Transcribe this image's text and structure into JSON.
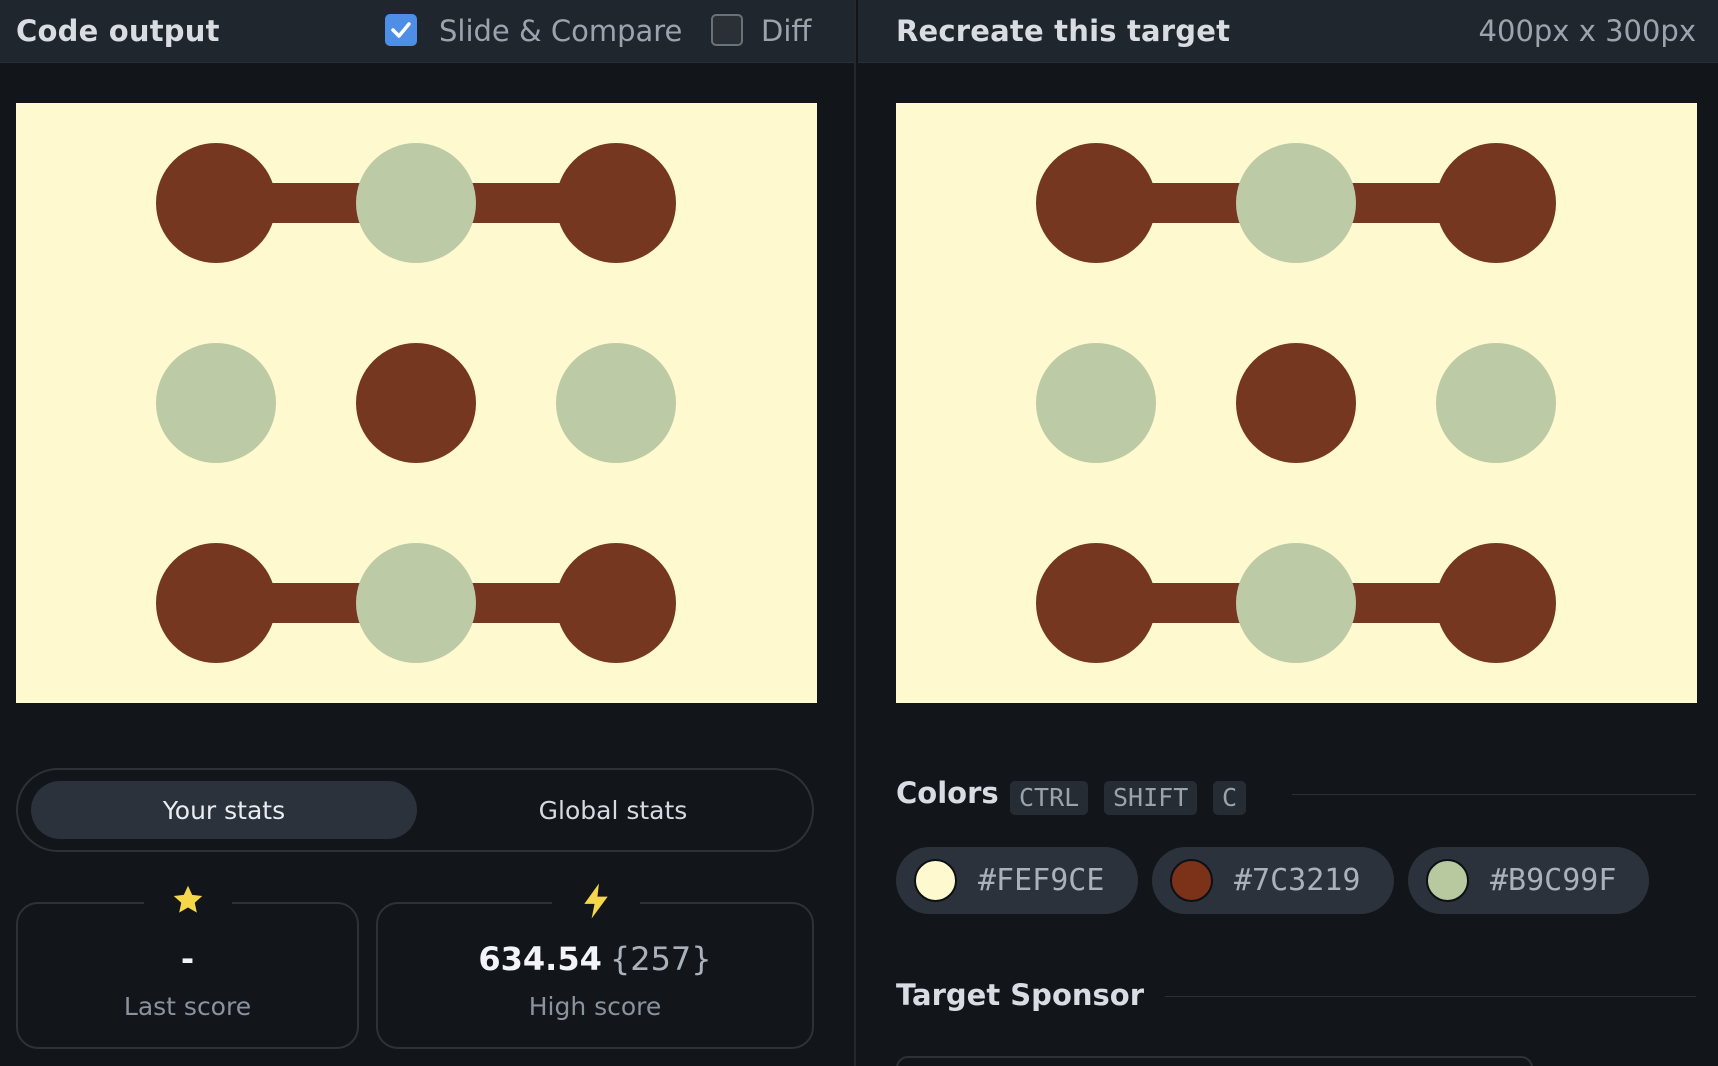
{
  "left_header": {
    "title": "Code output",
    "slide_compare_label": "Slide & Compare",
    "slide_compare_checked": true,
    "diff_label": "Diff",
    "diff_checked": false
  },
  "right_header": {
    "title": "Recreate this target",
    "dimensions": "400px x 300px"
  },
  "stats": {
    "tabs": [
      "Your stats",
      "Global stats"
    ],
    "active_tab": "Your stats",
    "last_score": {
      "icon": "star-icon",
      "value": "-",
      "label": "Last score"
    },
    "high_score": {
      "icon": "lightning-icon",
      "value": "634.54",
      "count": "{257}",
      "label": "High score"
    }
  },
  "colors_section": {
    "title": "Colors",
    "shortcut_keys": [
      "CTRL",
      "SHIFT",
      "C"
    ],
    "swatches": [
      "#FEF9CE",
      "#7C3219",
      "#B9C99F"
    ]
  },
  "sponsor_section": {
    "title": "Target Sponsor"
  },
  "palette": {
    "background": "#fef9ce",
    "brown": "#763720",
    "sage": "#bccaa5",
    "accent_blue": "#4f8ee6",
    "star_yellow": "#f6d64a"
  }
}
